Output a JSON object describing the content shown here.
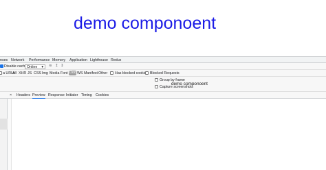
{
  "page": {
    "heading": "demo componoent"
  },
  "devtools": {
    "panel_tabs": [
      "nses",
      "Network",
      "Performance",
      "Memory",
      "Application",
      "Lighthouse",
      "Redux"
    ],
    "disable_cache_label": "Disable cache",
    "throttle_value": "Online",
    "filters": {
      "hide_data_urls": "a URLs",
      "types": [
        "All",
        "XHR",
        "JS",
        "CSS",
        "Img",
        "Media",
        "Font",
        "Doc",
        "WS",
        "Manifest",
        "Other"
      ],
      "selected_type": "Doc",
      "has_blocked_cookies": "Has blocked cookies",
      "blocked_requests": "Blocked Requests"
    },
    "settings": {
      "group_by_frame": "Group by frame",
      "capture_screenshots": "Capture screenshots"
    },
    "detail_tabs": [
      "Headers",
      "Preview",
      "Response",
      "Initiator",
      "Timing",
      "Cookies"
    ],
    "active_detail_tab": "Preview",
    "preview_content": "demo componoent"
  }
}
